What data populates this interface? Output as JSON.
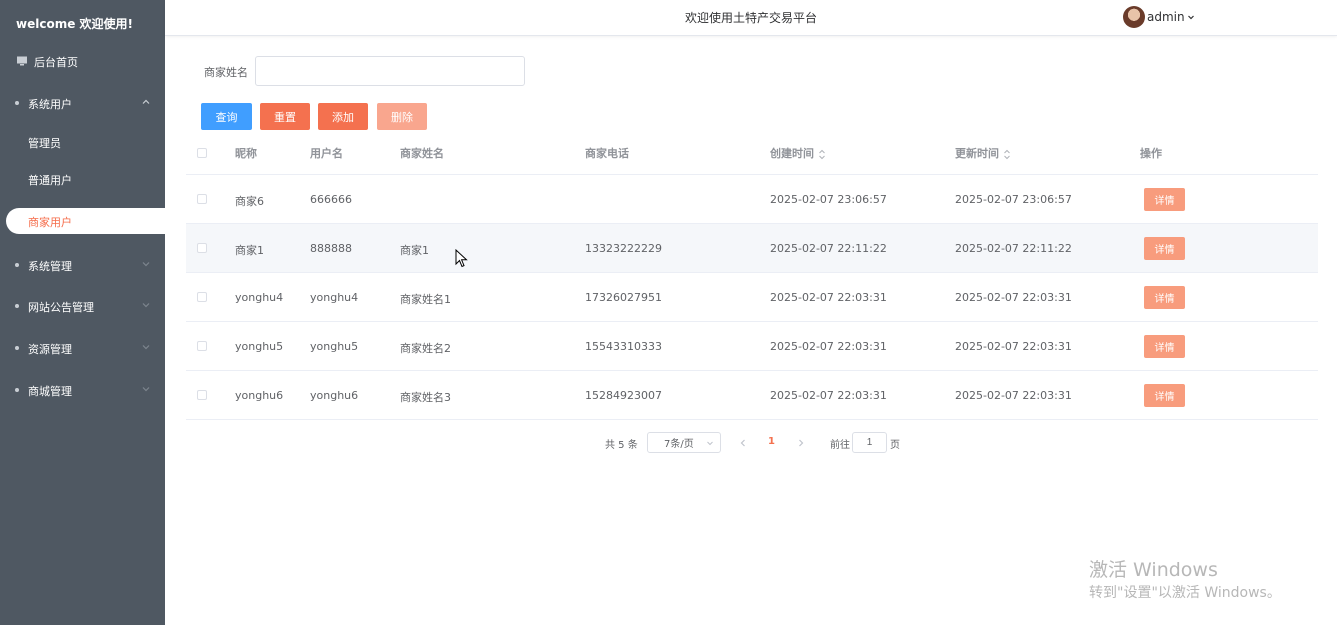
{
  "sidebar": {
    "welcome": "welcome 欢迎使用!",
    "items": [
      {
        "label": "后台首页",
        "icon": "monitor-icon"
      },
      {
        "label": "系统用户",
        "expanded": true
      },
      {
        "label": "管理员"
      },
      {
        "label": "普通用户"
      },
      {
        "label": "商家用户",
        "active": true
      },
      {
        "label": "系统管理"
      },
      {
        "label": "网站公告管理"
      },
      {
        "label": "资源管理"
      },
      {
        "label": "商城管理"
      }
    ]
  },
  "header": {
    "title": "欢迎使用土特产交易平台",
    "user": "admin"
  },
  "search": {
    "label": "商家姓名",
    "value": ""
  },
  "buttons": {
    "query": "查询",
    "reset": "重置",
    "add": "添加",
    "delete": "删除"
  },
  "table": {
    "columns": [
      "昵称",
      "用户名",
      "商家姓名",
      "商家电话",
      "创建时间",
      "更新时间",
      "操作"
    ],
    "rows": [
      {
        "nickname": "商家6",
        "username": "666666",
        "name": "",
        "phone": "",
        "created": "2025-02-07 23:06:57",
        "updated": "2025-02-07 23:06:57"
      },
      {
        "nickname": "商家1",
        "username": "888888",
        "name": "商家1",
        "phone": "13323222229",
        "created": "2025-02-07 22:11:22",
        "updated": "2025-02-07 22:11:22"
      },
      {
        "nickname": "yonghu4",
        "username": "yonghu4",
        "name": "商家姓名1",
        "phone": "17326027951",
        "created": "2025-02-07 22:03:31",
        "updated": "2025-02-07 22:03:31"
      },
      {
        "nickname": "yonghu5",
        "username": "yonghu5",
        "name": "商家姓名2",
        "phone": "15543310333",
        "created": "2025-02-07 22:03:31",
        "updated": "2025-02-07 22:03:31"
      },
      {
        "nickname": "yonghu6",
        "username": "yonghu6",
        "name": "商家姓名3",
        "phone": "15284923007",
        "created": "2025-02-07 22:03:31",
        "updated": "2025-02-07 22:03:31"
      }
    ],
    "detail_label": "详情"
  },
  "pagination": {
    "total": "共 5 条",
    "page_size": "7条/页",
    "current_page": "1",
    "goto_label": "前往",
    "goto_value": "1",
    "goto_suffix": "页"
  },
  "watermark": {
    "title": "激活 Windows",
    "subtitle": "转到\"设置\"以激活 Windows。"
  },
  "colors": {
    "sidebar_bg": "#4f5862",
    "primary": "#409eff",
    "accent": "#f4714f",
    "detail": "#f89c7d"
  }
}
